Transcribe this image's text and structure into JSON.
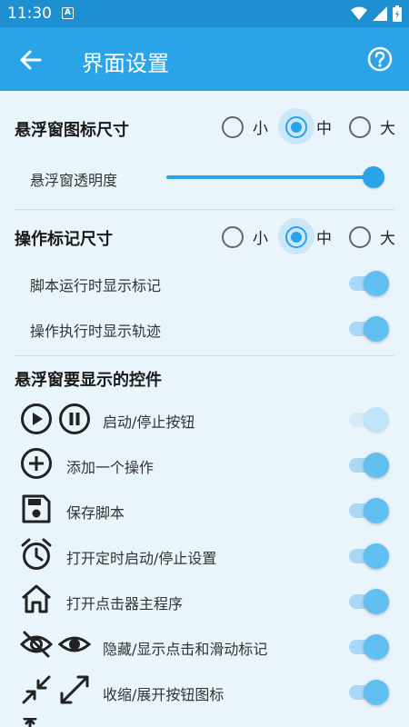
{
  "status_bar": {
    "time": "11:30",
    "badge": "A"
  },
  "app_bar": {
    "title": "界面设置"
  },
  "float_icon_size": {
    "title": "悬浮窗图标尺寸",
    "options": [
      "小",
      "中",
      "大"
    ],
    "selected": "中"
  },
  "float_opacity": {
    "label": "悬浮窗透明度",
    "value": 1.0
  },
  "marker_size": {
    "title": "操作标记尺寸",
    "options": [
      "小",
      "中",
      "大"
    ],
    "selected": "中"
  },
  "toggles": [
    {
      "label": "脚本运行时显示标记",
      "on": true
    },
    {
      "label": "操作执行时显示轨迹",
      "on": true
    }
  ],
  "controls_section": {
    "title": "悬浮窗要显示的控件"
  },
  "controls": [
    {
      "label": "启动/停止按钮",
      "icons": [
        "play-circle-icon",
        "pause-circle-icon"
      ],
      "on": true,
      "disabled": true
    },
    {
      "label": "添加一个操作",
      "icons": [
        "add-circle-icon"
      ],
      "on": true,
      "disabled": false
    },
    {
      "label": "保存脚本",
      "icons": [
        "save-icon"
      ],
      "on": true,
      "disabled": false
    },
    {
      "label": "打开定时启动/停止设置",
      "icons": [
        "alarm-clock-icon"
      ],
      "on": true,
      "disabled": false
    },
    {
      "label": "打开点击器主程序",
      "icons": [
        "home-icon"
      ],
      "on": true,
      "disabled": false
    },
    {
      "label": "隐藏/显示点击和滑动标记",
      "icons": [
        "eye-off-icon",
        "eye-icon"
      ],
      "on": true,
      "disabled": false
    },
    {
      "label": "收缩/展开按钮图标",
      "icons": [
        "collapse-icon",
        "expand-icon"
      ],
      "on": true,
      "disabled": false
    }
  ],
  "colors": {
    "status_bar": "#1e8fd0",
    "app_bar": "#2aa3e8",
    "accent": "#2aa3e8",
    "background": "#e9f5fb"
  }
}
